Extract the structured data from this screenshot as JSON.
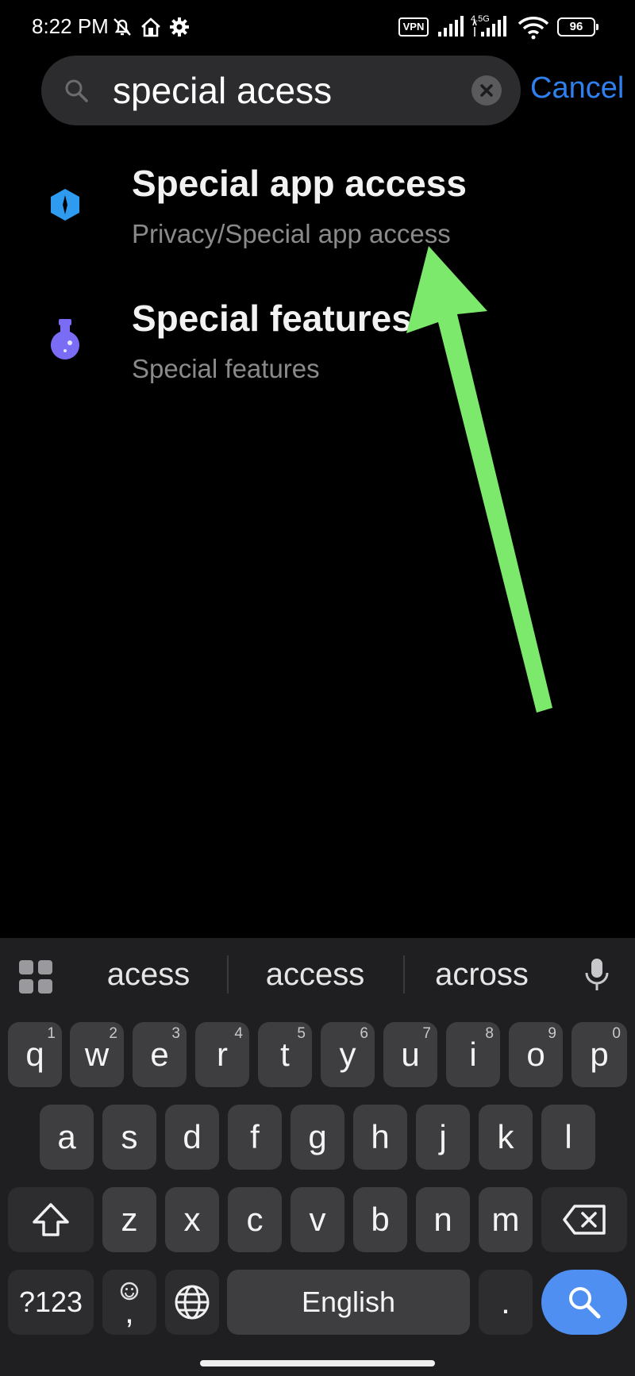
{
  "status": {
    "time": "8:22 PM",
    "vpn": "VPN",
    "network": "4.5G",
    "battery": "96"
  },
  "search": {
    "query": "special acess",
    "cancel_label": "Cancel"
  },
  "results": [
    {
      "title": "Special app access",
      "subtitle": "Privacy/Special app access"
    },
    {
      "title": "Special features",
      "subtitle": "Special features"
    }
  ],
  "keyboard": {
    "suggestions": [
      "acess",
      "access",
      "across"
    ],
    "row1": [
      {
        "key": "q",
        "hint": "1"
      },
      {
        "key": "w",
        "hint": "2"
      },
      {
        "key": "e",
        "hint": "3"
      },
      {
        "key": "r",
        "hint": "4"
      },
      {
        "key": "t",
        "hint": "5"
      },
      {
        "key": "y",
        "hint": "6"
      },
      {
        "key": "u",
        "hint": "7"
      },
      {
        "key": "i",
        "hint": "8"
      },
      {
        "key": "o",
        "hint": "9"
      },
      {
        "key": "p",
        "hint": "0"
      }
    ],
    "row2": [
      "a",
      "s",
      "d",
      "f",
      "g",
      "h",
      "j",
      "k",
      "l"
    ],
    "row3": [
      "z",
      "x",
      "c",
      "v",
      "b",
      "n",
      "m"
    ],
    "symbols_label": "?123",
    "comma_label": ",",
    "space_label": "English",
    "period_label": "."
  },
  "colors": {
    "accent": "#2f80ed",
    "arrow": "#7ce86c",
    "privacy_icon": "#2f9bf0",
    "features_icon": "#7b6cf6",
    "search_key": "#4f8ff2"
  },
  "icons": [
    "do-not-disturb-icon",
    "home-icon",
    "settings-gear-icon",
    "signal-icon",
    "wifi-icon",
    "search-icon",
    "clear-icon",
    "shield-icon",
    "potion-icon",
    "apps-grid-icon",
    "microphone-icon",
    "shift-icon",
    "backspace-icon",
    "emoji-icon",
    "globe-icon"
  ]
}
